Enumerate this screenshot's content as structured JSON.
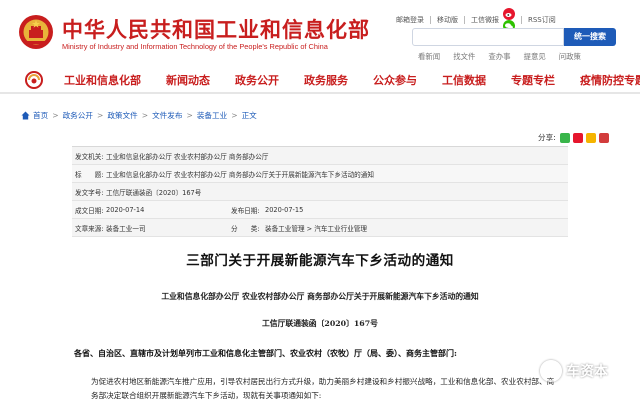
{
  "header": {
    "site_title": "中华人民共和国工业和信息化部",
    "site_subtitle": "Ministry of Industry and Information Technology of the People's Republic of China",
    "top_links": [
      "邮箱登录",
      "移动版",
      "工信微报"
    ],
    "rss": "RSS订阅",
    "search_placeholder": "",
    "search_button": "统一搜索",
    "quick_links": [
      "看新闻",
      "找文件",
      "查办事",
      "提意见",
      "问政策"
    ]
  },
  "nav": {
    "items": [
      "工业和信息化部",
      "新闻动态",
      "政务公开",
      "政务服务",
      "公众参与",
      "工信数据",
      "专题专栏",
      "疫情防控专题"
    ]
  },
  "breadcrumb": {
    "items": [
      "首页",
      "政务公开",
      "政策文件",
      "文件发布",
      "装备工业",
      "正文"
    ]
  },
  "share": {
    "label": "分享:"
  },
  "meta": {
    "issuer_label": "发文机关:",
    "issuer": "工业和信息化部办公厅 农业农村部办公厅 商务部办公厅",
    "title_label": "标　　题:",
    "title": "工业和信息化部办公厅 农业农村部办公厅 商务部办公厅关于开展新能源汽车下乡活动的通知",
    "docno_label": "发文字号:",
    "docno": "工信厅联通装函〔2020〕167号",
    "created_label": "成文日期:",
    "created": "2020-07-14",
    "published_label": "发布日期:",
    "published": "2020-07-15",
    "source_label": "文章来源:",
    "source": "装备工业一司",
    "category_label": "分　　类:",
    "category": "装备工业管理 > 汽车工业行业管理"
  },
  "article": {
    "title": "三部门关于开展新能源汽车下乡活动的通知",
    "subheading": "工业和信息化部办公厅 农业农村部办公厅 商务部办公厅关于开展新能源汽车下乡活动的通知",
    "doc_number": "工信厅联通装函〔2020〕167号",
    "salutation": "各省、自治区、直辖市及计划单列市工业和信息化主管部门、农业农村（农牧）厅（局、委）、商务主管部门:",
    "body": "为促进农村地区新能源汽车推广应用，引导农村居民出行方式升级，助力美丽乡村建设和乡村振兴战略，工业和信息化部、农业农村部、商务部决定联合组织开展新能源汽车下乡活动，现就有关事项通知如下:"
  },
  "watermark": {
    "text": "车资本"
  },
  "colors": {
    "brand_red": "#c81e1e",
    "link_blue": "#1e5bb8"
  }
}
